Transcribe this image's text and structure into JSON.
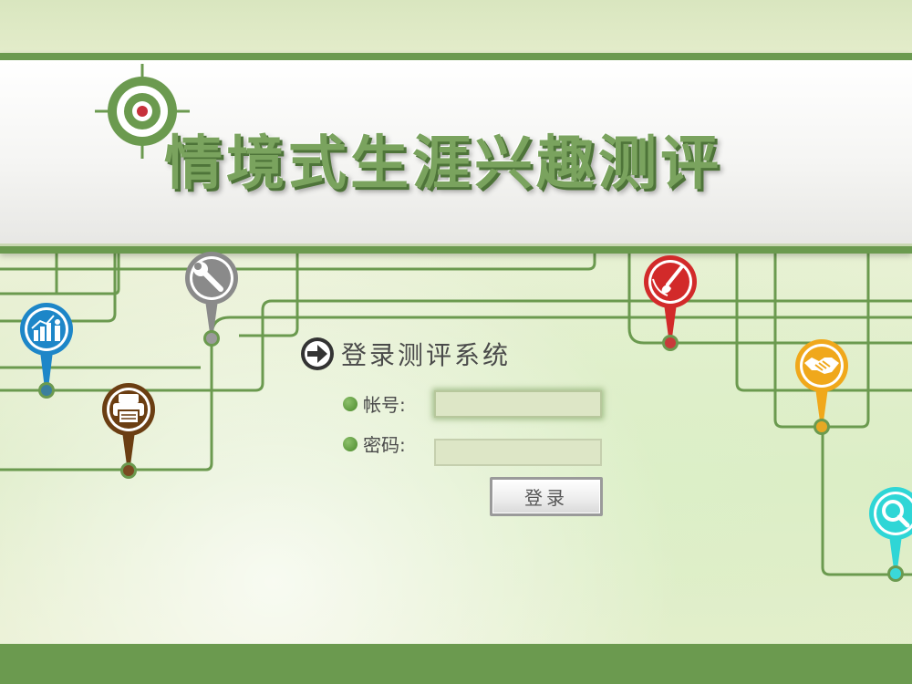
{
  "header": {
    "title": "情境式生涯兴趣测评",
    "logo_icon": "target-icon"
  },
  "login": {
    "heading": "登录测评系统",
    "heading_icon": "arrow-right-circle-icon",
    "account_label": "帐号:",
    "account_value": "",
    "password_label": "密码:",
    "password_value": "",
    "submit_label": "登录"
  },
  "pins": [
    {
      "name": "chart-pin",
      "icon": "bar-chart-person-icon",
      "color": "#1d86c8"
    },
    {
      "name": "tools-pin",
      "icon": "wrench-icon",
      "color": "#8a8a8a"
    },
    {
      "name": "printer-pin",
      "icon": "printer-icon",
      "color": "#6b3e12"
    },
    {
      "name": "paint-pin",
      "icon": "paintbrush-icon",
      "color": "#d22a2a"
    },
    {
      "name": "handshake-pin",
      "icon": "handshake-icon",
      "color": "#f0a81b"
    },
    {
      "name": "search-pin",
      "icon": "magnifier-icon",
      "color": "#2fd6d6"
    }
  ],
  "colors": {
    "theme_green": "#6b9a4f",
    "background": "#e4edcd"
  }
}
